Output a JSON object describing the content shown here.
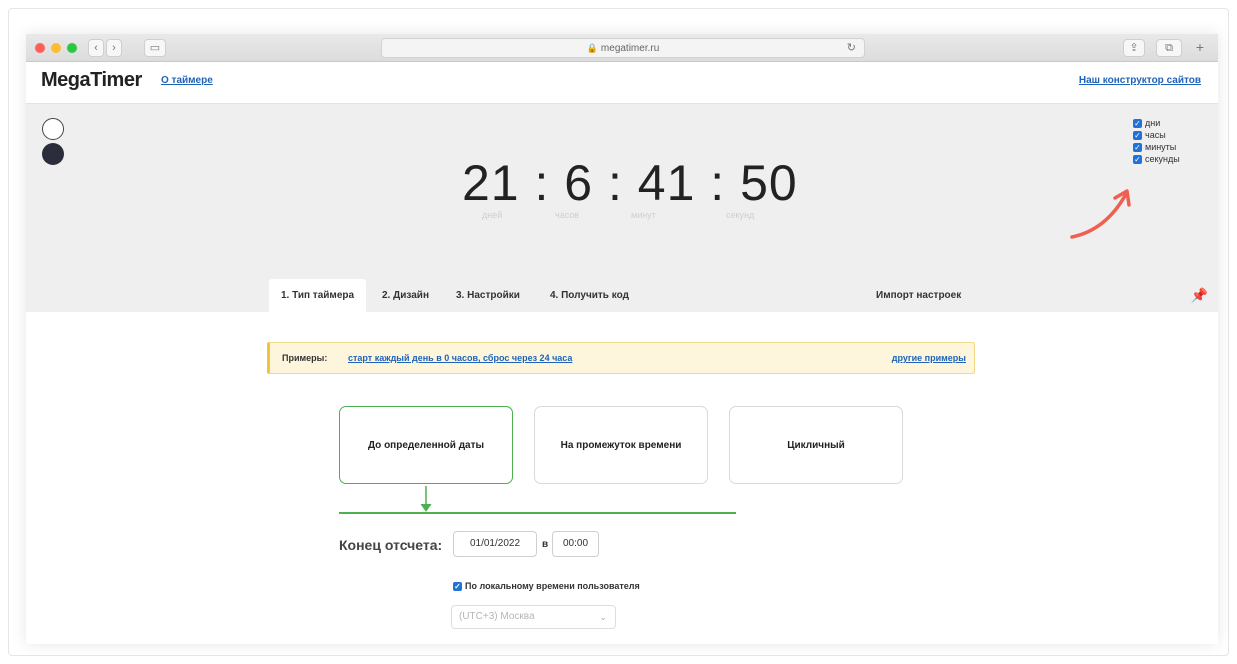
{
  "browser": {
    "url": "megatimer.ru",
    "lock_icon": "lock-icon",
    "reload_icon": "reload-icon",
    "colors": {
      "close": "#ff5f57",
      "minimize": "#febc2e",
      "maximize": "#28c840"
    }
  },
  "header": {
    "logo": "MegaTimer",
    "about_link": "О таймере",
    "builder_link": "Наш конструктор сайтов"
  },
  "timer": {
    "display": "21 : 6 : 41 : 50",
    "labels": [
      "дней",
      "часов",
      "минут",
      "секунд"
    ],
    "theme_options": [
      "light",
      "dark"
    ],
    "unit_checks": [
      {
        "label": "дни",
        "checked": true
      },
      {
        "label": "часы",
        "checked": true
      },
      {
        "label": "минуты",
        "checked": true
      },
      {
        "label": "секунды",
        "checked": true
      }
    ]
  },
  "tabs": [
    {
      "label": "1. Тип таймера",
      "active": true
    },
    {
      "label": "2. Дизайн",
      "active": false
    },
    {
      "label": "3. Настройки",
      "active": false
    },
    {
      "label": "4. Получить код",
      "active": false
    }
  ],
  "import_label": "Импорт настроек",
  "pin_icon": "pin-icon",
  "examples": {
    "label": "Примеры:",
    "link": "старт каждый день в 0 часов, сброс через 24 часа",
    "more": "другие примеры"
  },
  "types": [
    {
      "label": "До определенной даты",
      "selected": true
    },
    {
      "label": "На промежуток времени",
      "selected": false
    },
    {
      "label": "Цикличный",
      "selected": false
    }
  ],
  "end": {
    "label": "Конец отсчета:",
    "date": "01/01/2022",
    "at": "в",
    "time": "00:00"
  },
  "local_time": {
    "label": "По локальному времени пользователя",
    "checked": true
  },
  "timezone": "(UTC+3) Москва",
  "accent": "#4caf50",
  "link_color": "#1e63b8"
}
